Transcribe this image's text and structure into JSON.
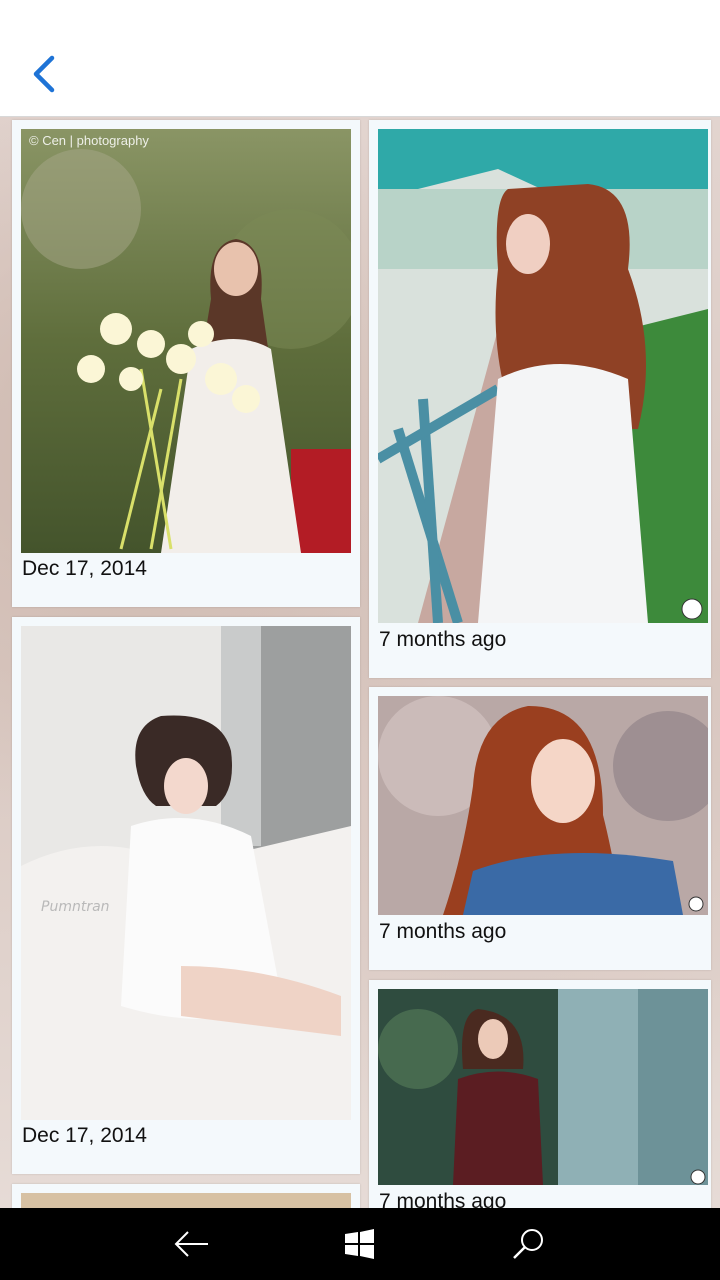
{
  "header": {
    "back_icon": "chevron-left-icon",
    "accent": "#1e73d6"
  },
  "photos": [
    {
      "date": "Dec 17, 2014",
      "watermark": "© Cen | photography"
    },
    {
      "date": "7 months ago"
    },
    {
      "date": "Dec 17, 2014"
    },
    {
      "date": "7 months ago"
    },
    {
      "date": "7 months ago"
    }
  ],
  "navbar": {
    "back_icon": "back-arrow-icon",
    "home_icon": "windows-logo-icon",
    "search_icon": "search-icon"
  }
}
